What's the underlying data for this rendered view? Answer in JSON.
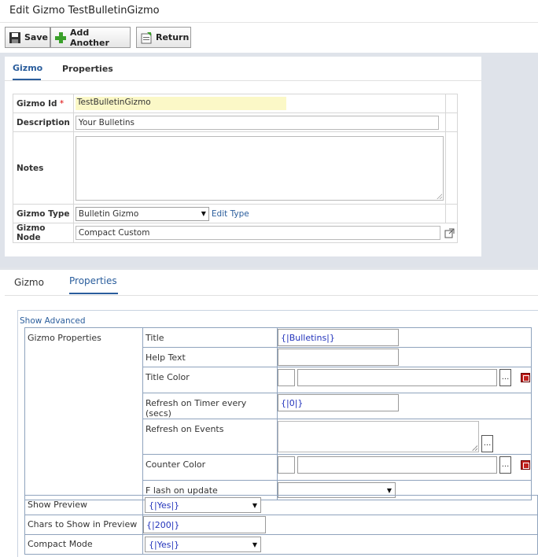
{
  "page_title": "Edit Gizmo TestBulletinGizmo",
  "toolbar": {
    "save_label": "Save",
    "add_another_label": "Add Another",
    "return_label": "Return"
  },
  "top_panel": {
    "tabs": [
      "Gizmo",
      "Properties"
    ],
    "active_tab": "Gizmo",
    "fields": {
      "gizmo_id_label": "Gizmo Id",
      "gizmo_id_required": "*",
      "gizmo_id_value": "TestBulletinGizmo",
      "description_label": "Description",
      "description_value": "Your Bulletins",
      "notes_label": "Notes",
      "notes_value": "",
      "gizmo_type_label": "Gizmo Type",
      "gizmo_type_value": "Bulletin Gizmo",
      "edit_type_link": "Edit Type",
      "gizmo_node_label": "Gizmo Node",
      "gizmo_node_value": "Compact Custom"
    }
  },
  "bottom_panel": {
    "tabs": [
      "Gizmo",
      "Properties"
    ],
    "active_tab": "Properties",
    "show_advanced_link": "Show Advanced",
    "group_label": "Gizmo Properties",
    "props": {
      "title_label": "Title",
      "title_value": "{|Bulletins|}",
      "help_text_label": "Help Text",
      "help_text_value": "",
      "title_color_label": "Title Color",
      "refresh_timer_label": "Refresh on Timer every (secs)",
      "refresh_timer_value": "{|0|}",
      "refresh_events_label": "Refresh on Events",
      "counter_color_label": "Counter Color",
      "flash_label": "F lash on update",
      "flash_value": ""
    },
    "rows": {
      "show_preview_label": "Show Preview",
      "show_preview_value": "{|Yes|}",
      "chars_label": "Chars to Show in Preview",
      "chars_value": "{|200|}",
      "compact_label": "Compact Mode",
      "compact_value": "{|Yes|}"
    }
  },
  "colors": {
    "accent": "#2a5d9c",
    "id_highlight": "#fbf8c7",
    "panel_background": "#dfe3ea",
    "add_icon": "#3aa02a",
    "color_picker_icon": "#c0221f"
  }
}
